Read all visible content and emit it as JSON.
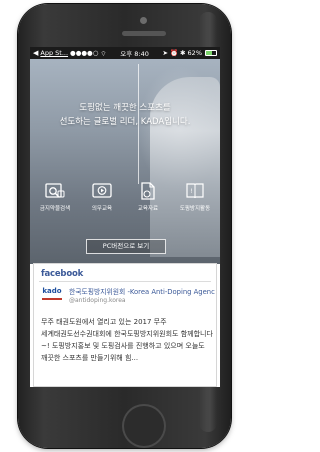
{
  "status_bar": {
    "back_app": "App St...",
    "signal": "●●●●○",
    "time": "오후 8:40",
    "battery": "62%"
  },
  "hero": {
    "title_line1": "도핑없는 깨끗한 스포츠를",
    "title_line2": "선도하는 글로벌 리더, KADA입니다."
  },
  "menu": [
    {
      "label": "금지약물검색",
      "icon": "search-drug-icon"
    },
    {
      "label": "의무교육",
      "icon": "video-play-icon"
    },
    {
      "label": "교육자료",
      "icon": "document-icon"
    },
    {
      "label": "도핑방지활동",
      "icon": "book-icon"
    }
  ],
  "pc_button": "PC버전으로 보기",
  "facebook": {
    "logo": "facebook",
    "kado_logo": "kado",
    "page_name": "한국도핑방지위원회 -Korea Anti-Doping Agency",
    "handle": "@antidoping.korea",
    "post": "무주 태권도원에서 열리고 있는 2017 무주 세계태권도선수권대회에 한국도핑방지위원회도 함께합니다~! 도핑방지홍보 및 도핑검사를 진행하고 있으며 오늘도 깨끗한 스포츠를 만들기위해 힘..."
  }
}
